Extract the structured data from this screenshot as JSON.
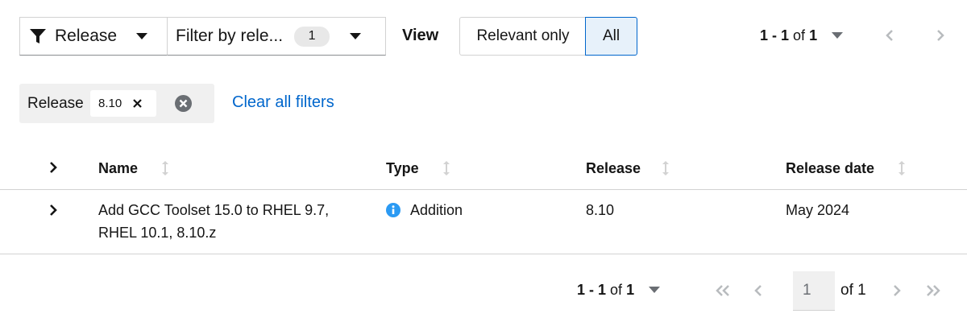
{
  "toolbar": {
    "attribute_label": "Release",
    "value_placeholder": "Filter by rele...",
    "selected_count": "1",
    "view_label": "View",
    "toggle_relevant_label": "Relevant only",
    "toggle_all_label": "All",
    "toggle_selected": "All",
    "pagination": {
      "range": "1 - 1",
      "of_label": "of",
      "total": "1"
    }
  },
  "filters": {
    "category": "Release",
    "chips": [
      {
        "label": "8.10"
      }
    ],
    "clear_all_label": "Clear all filters"
  },
  "table": {
    "columns": [
      "Name",
      "Type",
      "Release",
      "Release date"
    ],
    "rows": [
      {
        "name_line1": "Add GCC Toolset 15.0 to RHEL 9.7,",
        "name_line2": "RHEL 10.1, 8.10.z",
        "type": "Addition",
        "release": "8.10",
        "release_date": "May 2024"
      }
    ]
  },
  "bottom_pagination": {
    "range": "1 - 1",
    "of_label": "of",
    "total": "1",
    "page_input_placeholder": "1",
    "page_of_label": "of 1"
  },
  "colors": {
    "link": "#0066cc",
    "info": "#2b9af3",
    "toggle_selected_bg": "#e7f1fa"
  }
}
